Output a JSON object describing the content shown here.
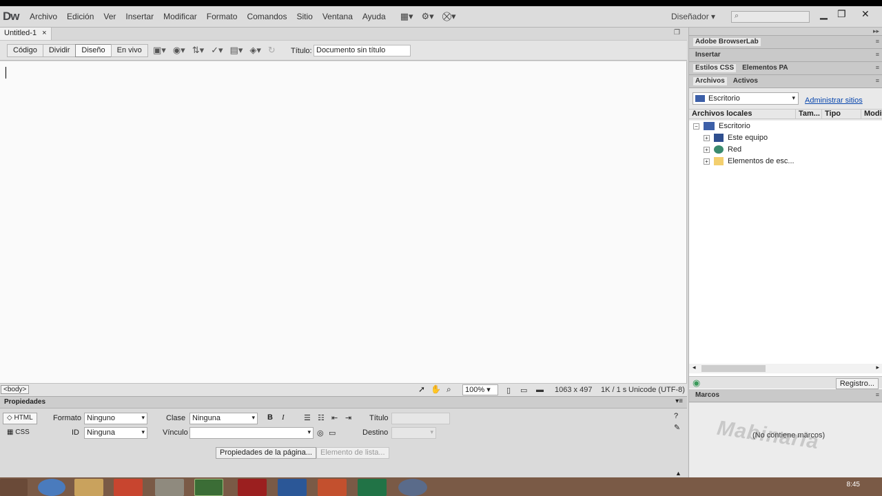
{
  "app": {
    "logo": "Dw",
    "menu": [
      "Archivo",
      "Edición",
      "Ver",
      "Insertar",
      "Modificar",
      "Formato",
      "Comandos",
      "Sitio",
      "Ventana",
      "Ayuda"
    ],
    "workspace": "Diseñador",
    "workspace_arrow": "▾",
    "search_icon": "⌕"
  },
  "document": {
    "tab_name": "Untitled-1",
    "tab_close": "×",
    "views": [
      "Código",
      "Dividir",
      "Diseño",
      "En vivo"
    ],
    "active_view": "Diseño",
    "title_label": "Título:",
    "title_value": "Documento sin título"
  },
  "statusbar": {
    "tag": "<body>",
    "zoom": "100%",
    "dimensions": "1063 x 497",
    "size": "1K / 1 s",
    "encoding": "Unicode (UTF-8)"
  },
  "properties": {
    "header": "Propiedades",
    "html_btn": "HTML",
    "css_btn": "CSS",
    "formato_label": "Formato",
    "formato_value": "Ninguno",
    "id_label": "ID",
    "id_value": "Ninguna",
    "clase_label": "Clase",
    "clase_value": "Ninguna",
    "vinculo_label": "Vínculo",
    "vinculo_value": "",
    "titulo_label": "Título",
    "destino_label": "Destino",
    "page_props_btn": "Propiedades de la página...",
    "list_item_btn": "Elemento de lista..."
  },
  "panels": {
    "browserlab": "Adobe BrowserLab",
    "insertar": "Insertar",
    "estilos": "Estilos CSS",
    "elementos": "Elementos PA",
    "archivos": "Archivos",
    "activos": "Activos",
    "site": "Escritorio",
    "manage": "Administrar sitios",
    "columns": [
      "Archivos locales",
      "Tam...",
      "Tipo",
      "Modifi"
    ],
    "tree": [
      {
        "label": "Escritorio",
        "expander": "−"
      },
      {
        "label": "Este equipo",
        "expander": "+"
      },
      {
        "label": "Red",
        "expander": "+"
      },
      {
        "label": "Elementos de esc...",
        "expander": "+"
      }
    ],
    "log_btn": "Registro...",
    "marcos": "Marcos",
    "no_frames": "(No contiene marcos)",
    "watermark": "Mabinaria"
  },
  "taskbar": {
    "clock": "8:45"
  }
}
